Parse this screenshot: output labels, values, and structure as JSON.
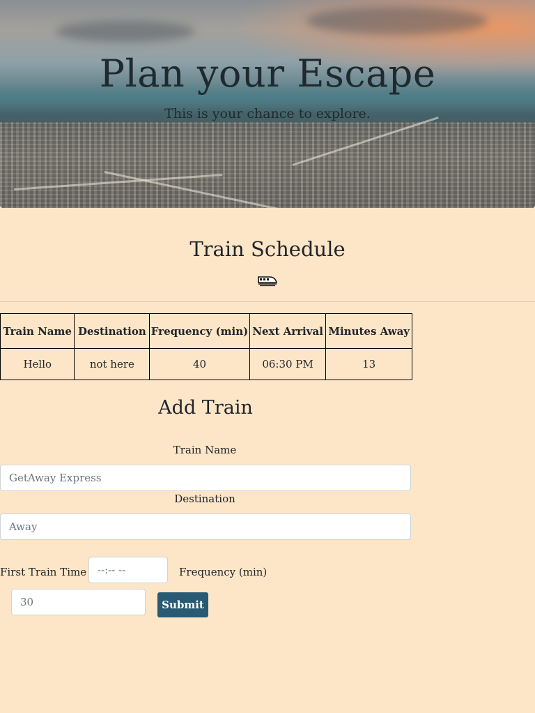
{
  "hero": {
    "title": "Plan your Escape",
    "subtitle": "This is your chance to explore."
  },
  "schedule": {
    "title": "Train Schedule",
    "icon": "train-icon",
    "columns": [
      "Train Name",
      "Destination",
      "Frequency (min)",
      "Next Arrival",
      "Minutes Away"
    ],
    "rows": [
      [
        "Hello",
        "not here",
        "40",
        "06:30 PM",
        "13"
      ]
    ]
  },
  "form": {
    "title": "Add Train",
    "train_name_label": "Train Name",
    "train_name_placeholder": "GetAway Express",
    "destination_label": "Destination",
    "destination_placeholder": "Away",
    "first_time_label": "First Train Time",
    "first_time_placeholder": "--:-- --",
    "frequency_label": "Frequency (min)",
    "frequency_placeholder": "30",
    "submit_label": "Submit"
  },
  "colors": {
    "background": "#fde5c8",
    "button": "#285a73"
  }
}
